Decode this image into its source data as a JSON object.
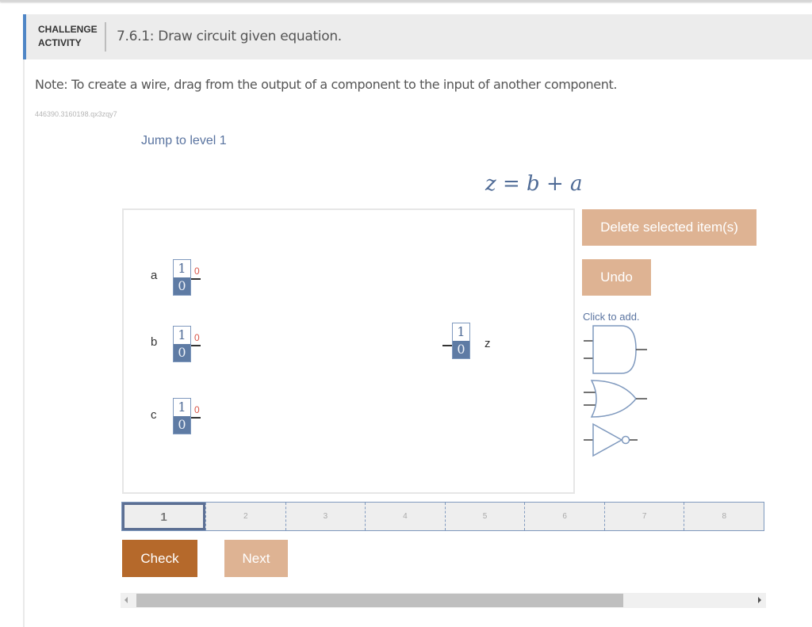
{
  "header": {
    "kind_line1": "CHALLENGE",
    "kind_line2": "ACTIVITY",
    "title": "7.6.1: Draw circuit given equation."
  },
  "note": "Note: To create a wire, drag from the output of a component to the input of another component.",
  "activity_id": "446390.3160198.qx3zqy7",
  "jump_link": "Jump to level 1",
  "equation": {
    "lhs": "z",
    "eq": "=",
    "term1": "b",
    "plus": "+",
    "term2": "a"
  },
  "canvas": {
    "inputs": [
      {
        "name": "a",
        "one": "1",
        "zero": "0",
        "output_value": "0"
      },
      {
        "name": "b",
        "one": "1",
        "zero": "0",
        "output_value": "0"
      },
      {
        "name": "c",
        "one": "1",
        "zero": "0",
        "output_value": "0"
      }
    ],
    "output": {
      "name": "z",
      "one": "1",
      "zero": "0"
    }
  },
  "toolbar": {
    "delete_label": "Delete selected item(s)",
    "undo_label": "Undo",
    "click_to_add": "Click to add.",
    "gates": [
      "and-gate",
      "or-gate",
      "not-gate"
    ]
  },
  "levels": {
    "current": 1,
    "items": [
      "1",
      "2",
      "3",
      "4",
      "5",
      "6",
      "7",
      "8"
    ]
  },
  "actions": {
    "check_label": "Check",
    "next_label": "Next"
  },
  "scrollbar": {
    "position_fraction": 0.0,
    "visible_fraction": 0.76
  },
  "colors": {
    "accent_blue": "#4f86c6",
    "switch_blue": "#5e7ba4",
    "check_button": "#b5692b",
    "light_button": "#deb393",
    "output_value_red": "#d9574a"
  }
}
